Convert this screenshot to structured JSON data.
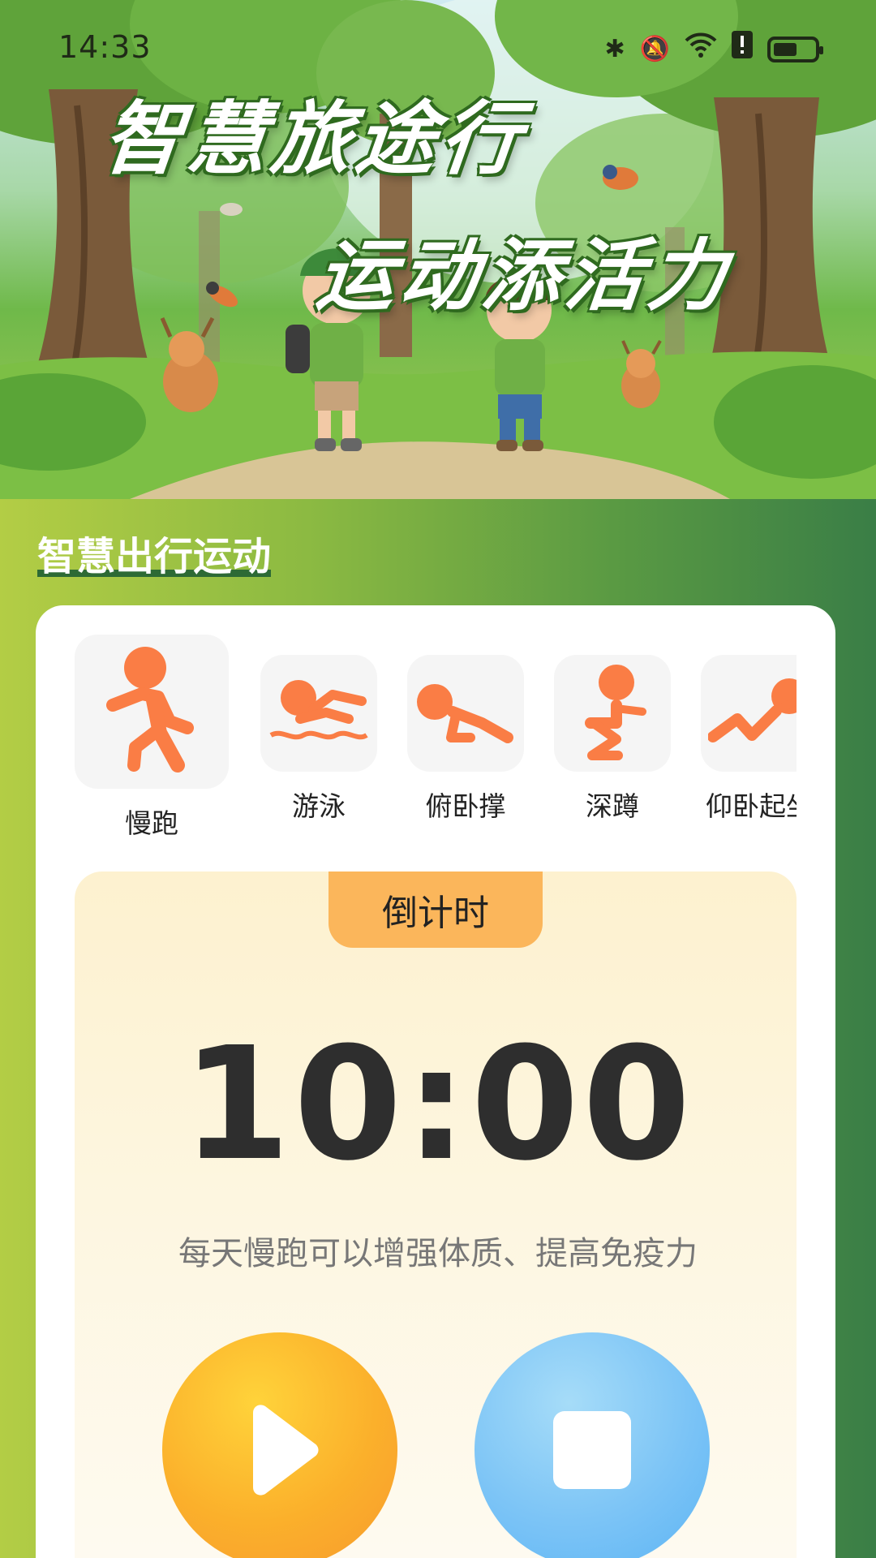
{
  "status_bar": {
    "time": "14:33",
    "icons": [
      "bluetooth-icon",
      "mute-icon",
      "wifi-icon",
      "alert-icon",
      "battery-icon"
    ]
  },
  "hero": {
    "title_line1": "智慧旅途行",
    "title_line2": "运动添活力"
  },
  "section": {
    "title": "智慧出行运动"
  },
  "exercises": [
    {
      "label": "慢跑",
      "icon": "running-icon",
      "selected": true
    },
    {
      "label": "游泳",
      "icon": "swimming-icon",
      "selected": false
    },
    {
      "label": "俯卧撑",
      "icon": "pushup-icon",
      "selected": false
    },
    {
      "label": "深蹲",
      "icon": "squat-icon",
      "selected": false
    },
    {
      "label": "仰卧起坐",
      "icon": "situp-icon",
      "selected": false
    }
  ],
  "timer": {
    "tab_label": "倒计时",
    "display": "10:00",
    "tip": "每天慢跑可以增强体质、提高免疫力"
  },
  "controls": {
    "play": "play-icon",
    "stop": "stop-icon"
  },
  "colors": {
    "accent_orange": "#fa7d45",
    "tab_orange": "#fbb65b",
    "play_gradient_start": "#ffd33a",
    "stop_gradient_start": "#a6dcf8",
    "green_left": "#b3cd45",
    "green_right": "#3a7e46"
  }
}
